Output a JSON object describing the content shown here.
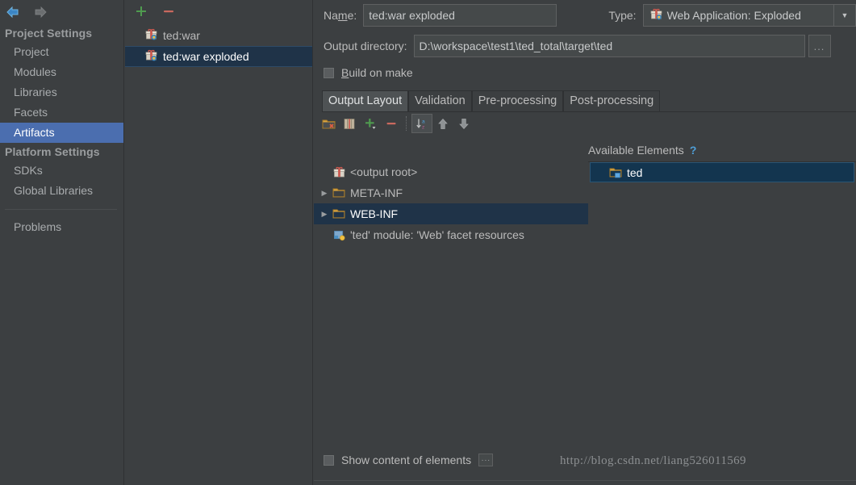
{
  "window": {
    "nav": {
      "back_icon": "arrow-left-icon",
      "forward_icon": "arrow-right-icon"
    }
  },
  "sidebar": {
    "groups": [
      {
        "title": "Project Settings",
        "items": [
          {
            "label": "Project",
            "selected": false
          },
          {
            "label": "Modules",
            "selected": false
          },
          {
            "label": "Libraries",
            "selected": false
          },
          {
            "label": "Facets",
            "selected": false
          },
          {
            "label": "Artifacts",
            "selected": true
          }
        ]
      },
      {
        "title": "Platform Settings",
        "items": [
          {
            "label": "SDKs",
            "selected": false
          },
          {
            "label": "Global Libraries",
            "selected": false
          }
        ]
      }
    ],
    "footer_item": {
      "label": "Problems",
      "selected": false
    }
  },
  "artifact_panel": {
    "toolbar": {
      "add_label": "+",
      "remove_label": "–"
    },
    "items": [
      {
        "label": "ted:war",
        "icon": "artifact-icon",
        "selected": false
      },
      {
        "label": "ted:war exploded",
        "icon": "artifact-icon",
        "selected": true
      }
    ]
  },
  "detail": {
    "name_label": "Na",
    "name_label_mnemonic": "m",
    "name_label_rest": "e:",
    "name_value": "ted:war exploded",
    "type_label": "Type:",
    "type_value": "Web Application: Exploded",
    "type_icon": "artifact-icon",
    "output_dir_label": "Output directory:",
    "output_dir_value": "D:\\workspace\\test1\\ted_total\\target\\ted",
    "browse_label": "...",
    "build_on_make_label_mnemonic": "B",
    "build_on_make_label_rest": "uild on make",
    "build_on_make_checked": false,
    "tabs": [
      {
        "label": "Output Layout",
        "active": true
      },
      {
        "label": "Validation",
        "active": false
      },
      {
        "label": "Pre-processing",
        "active": false
      },
      {
        "label": "Post-processing",
        "active": false
      }
    ],
    "layout_toolbar": [
      {
        "name": "create-directory-icon",
        "glyph": "folder-star"
      },
      {
        "name": "create-archive-icon",
        "glyph": "archive"
      },
      {
        "name": "add-icon",
        "glyph": "plus"
      },
      {
        "name": "remove-icon",
        "glyph": "minus"
      },
      {
        "name": "sort-alphabetically-icon",
        "glyph": "sort-az"
      },
      {
        "name": "move-up-icon",
        "glyph": "arrow-up"
      },
      {
        "name": "move-down-icon",
        "glyph": "arrow-down"
      }
    ],
    "available_elements_label": "Available Elements",
    "help_label": "?",
    "output_tree": [
      {
        "label": "<output root>",
        "icon": "artifact-icon",
        "depth": 0,
        "expandable": false,
        "selected": false
      },
      {
        "label": "META-INF",
        "icon": "folder-icon",
        "depth": 1,
        "expandable": true,
        "selected": false
      },
      {
        "label": "WEB-INF",
        "icon": "folder-icon",
        "depth": 1,
        "expandable": true,
        "selected": true
      },
      {
        "label": "'ted' module: 'Web' facet resources",
        "icon": "module-facet-icon",
        "depth": 1,
        "expandable": false,
        "selected": false
      }
    ],
    "available_tree": [
      {
        "label": "ted",
        "icon": "module-folder-icon",
        "selected": true
      }
    ],
    "show_content_label": "Show content of elements",
    "show_content_checked": false,
    "show_content_more_label": "···"
  },
  "watermark": {
    "text": "http://blog.csdn.net/liang526011569"
  },
  "colors": {
    "background": "#3c3f41",
    "sidebar_selection": "#4b6eaf",
    "tree_selection": "#1f3348",
    "available_selection": "#13354f",
    "accent_blue": "#4f9fd8",
    "add_green": "#4f9b4f",
    "remove_red": "#c9695e",
    "text": "#bbbbbb"
  }
}
